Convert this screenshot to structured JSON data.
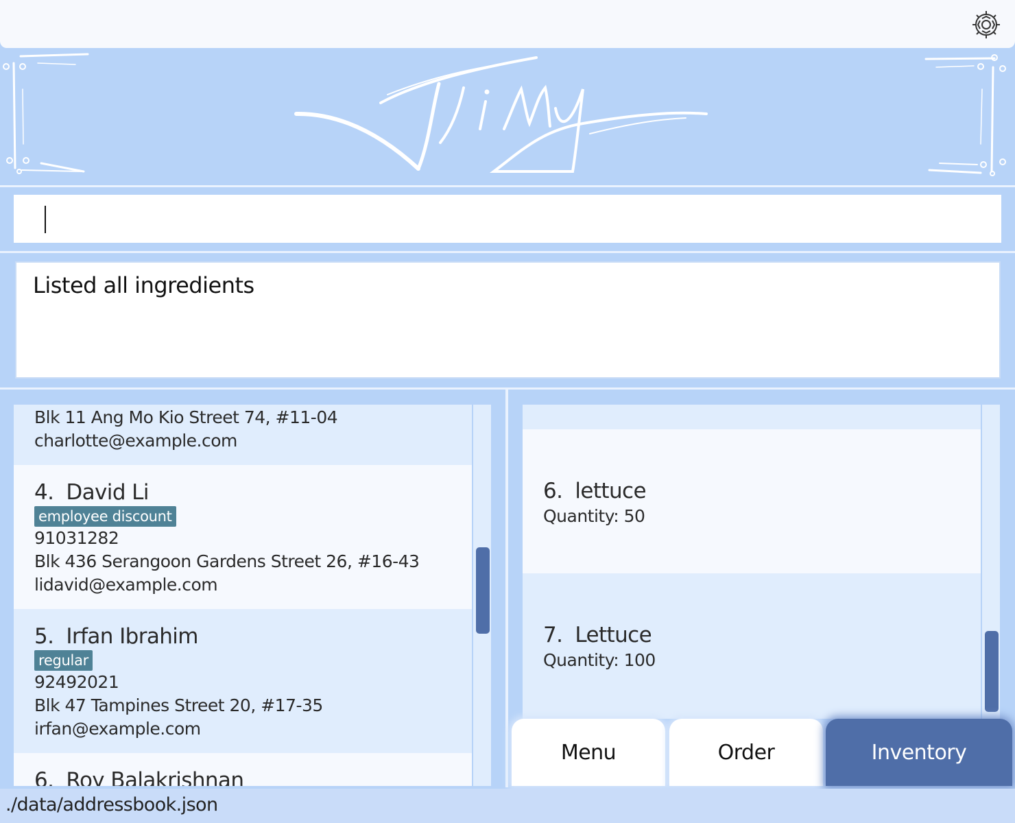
{
  "header": {
    "settings_icon": "gear-icon"
  },
  "banner": {
    "logo_text": "Jimy"
  },
  "command": {
    "value": "",
    "placeholder": ""
  },
  "result": {
    "message": "Listed all ingredients"
  },
  "customers": [
    {
      "index": "",
      "name": "",
      "tag": "",
      "phone": "",
      "address": "Blk 11 Ang Mo Kio Street 74, #11-04",
      "email": "charlotte@example.com"
    },
    {
      "index": "4.",
      "name": "David Li",
      "tag": "employee discount",
      "phone": "91031282",
      "address": "Blk 436 Serangoon Gardens Street 26, #16-43",
      "email": "lidavid@example.com"
    },
    {
      "index": "5.",
      "name": "Irfan Ibrahim",
      "tag": "regular",
      "phone": "92492021",
      "address": "Blk 47 Tampines Street 20, #17-35",
      "email": "irfan@example.com"
    },
    {
      "index": "6.",
      "name": "Roy Balakrishnan"
    }
  ],
  "ingredients": [
    {
      "index": "6.",
      "name": "lettuce",
      "quantity": "Quantity: 50"
    },
    {
      "index": "7.",
      "name": "Lettuce",
      "quantity": "Quantity: 100"
    }
  ],
  "tabs": {
    "menu": "Menu",
    "order": "Order",
    "inventory": "Inventory",
    "active": "Inventory"
  },
  "status": {
    "path": "./data/addressbook.json"
  },
  "colors": {
    "background": "#b7d3f8",
    "accent": "#4f6ea8",
    "tag": "#4f8296"
  }
}
